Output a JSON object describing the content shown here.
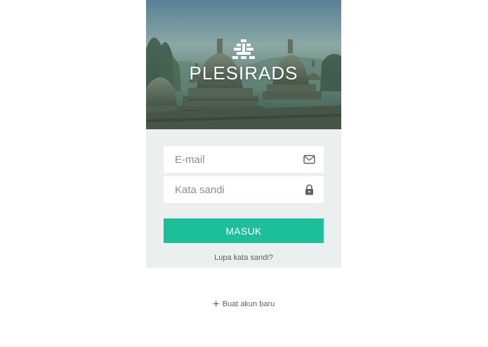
{
  "header": {
    "brand_name": "PLESIRADS",
    "logo_icon": "temple-logo-icon",
    "background_image": "borobudur-temple-stupas-photo"
  },
  "form": {
    "email": {
      "placeholder": "E-mail",
      "value": "",
      "icon": "envelope-icon"
    },
    "password": {
      "placeholder": "Kata sandi",
      "value": "",
      "icon": "lock-icon"
    },
    "login_label": "MASUK",
    "forgot_label": "Lupa kata sandi?"
  },
  "footer": {
    "signup_icon": "plus-icon",
    "signup_label": "Buat akun baru"
  },
  "colors": {
    "accent": "#1dbf9b",
    "panel_bg": "#eceff0",
    "text_muted": "#5d6166"
  }
}
